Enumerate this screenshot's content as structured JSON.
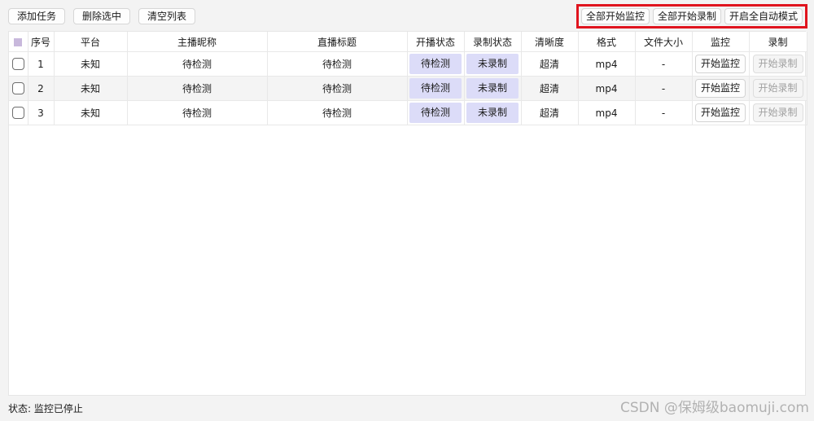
{
  "toolbar": {
    "add_task": "添加任务",
    "delete_selected": "删除选中",
    "clear_list": "清空列表"
  },
  "top_actions": {
    "start_all_monitor": "全部开始监控",
    "start_all_record": "全部开始录制",
    "auto_mode": "开启全自动模式"
  },
  "table": {
    "headers": {
      "select": "",
      "index": "序号",
      "platform": "平台",
      "nickname": "主播昵称",
      "title": "直播标题",
      "live_status": "开播状态",
      "record_status": "录制状态",
      "quality": "清晰度",
      "format": "格式",
      "file_size": "文件大小",
      "monitor": "监控",
      "record": "录制"
    },
    "rows": [
      {
        "index": "1",
        "platform": "未知",
        "nickname": "待检测",
        "title": "待检测",
        "live_status": "待检测",
        "record_status": "未录制",
        "quality": "超清",
        "format": "mp4",
        "file_size": "-",
        "monitor_btn": "开始监控",
        "record_btn": "开始录制"
      },
      {
        "index": "2",
        "platform": "未知",
        "nickname": "待检测",
        "title": "待检测",
        "live_status": "待检测",
        "record_status": "未录制",
        "quality": "超清",
        "format": "mp4",
        "file_size": "-",
        "monitor_btn": "开始监控",
        "record_btn": "开始录制"
      },
      {
        "index": "3",
        "platform": "未知",
        "nickname": "待检测",
        "title": "待检测",
        "live_status": "待检测",
        "record_status": "未录制",
        "quality": "超清",
        "format": "mp4",
        "file_size": "-",
        "monitor_btn": "开始监控",
        "record_btn": "开始录制"
      }
    ]
  },
  "status_bar": {
    "text": "状态: 监控已停止"
  },
  "watermark": "CSDN @保姆级baomuji.com",
  "colors": {
    "highlight_border": "#e0141e",
    "chip_bg": "#dcdcf8",
    "header_checkbox": "#c8b8dc"
  }
}
